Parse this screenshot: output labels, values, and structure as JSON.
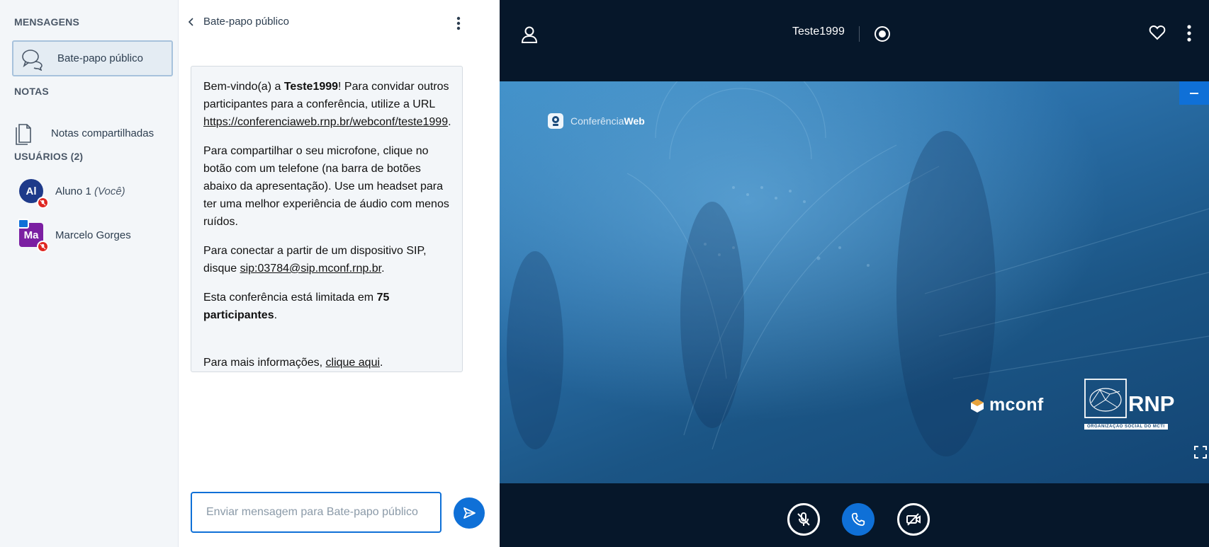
{
  "sidebar": {
    "messages_title": "MENSAGENS",
    "public_chat_label": "Bate-papo público",
    "notes_title": "NOTAS",
    "shared_notes_label": "Notas compartilhadas",
    "users_title": "USUÁRIOS (2)",
    "users": [
      {
        "initials": "Al",
        "name": "Aluno 1",
        "suffix": "(Você)",
        "color": "#1e3a8a"
      },
      {
        "initials": "Ma",
        "name": "Marcelo Gorges",
        "suffix": "",
        "color": "#7b1fa2"
      }
    ]
  },
  "chat": {
    "header_title": "Bate-papo público",
    "welcome": {
      "p1_a": "Bem-vindo(a) a ",
      "p1_b": "Teste1999",
      "p1_c": "! Para convidar outros participantes para a conferência, utilize a URL ",
      "p1_link": "https://conferenciaweb.rnp.br/webconf/teste1999",
      "p1_end": ".",
      "p2": "Para compartilhar o seu microfone, clique no botão com um telefone (na barra de botões abaixo da apresentação). Use um headset para ter uma melhor experiência de áudio com menos ruídos.",
      "p3_a": "Para conectar a partir de um dispositivo SIP, disque ",
      "p3_link": "sip:03784@sip.mconf.rnp.br",
      "p3_end": ".",
      "p4_a": "Esta conferência está limitada em ",
      "p4_b": "75 participantes",
      "p4_c": ".",
      "p5_a": "Para mais informações, ",
      "p5_link": "clique aqui",
      "p5_end": "."
    },
    "input_placeholder": "Enviar mensagem para Bate-papo público"
  },
  "main": {
    "meeting_title": "Teste1999",
    "presentation": {
      "cw_logo_a": "Conferência",
      "cw_logo_b": "Web",
      "mconf_logo": "mconf",
      "rnp_logo": "RNP",
      "rnp_sub": "ORGANIZAÇÃO SOCIAL DO MCTI"
    }
  },
  "colors": {
    "accent": "#0f70d7",
    "main_bg": "#06172a",
    "sidebar_bg": "#f3f6f9",
    "muted_badge": "#df2721"
  }
}
